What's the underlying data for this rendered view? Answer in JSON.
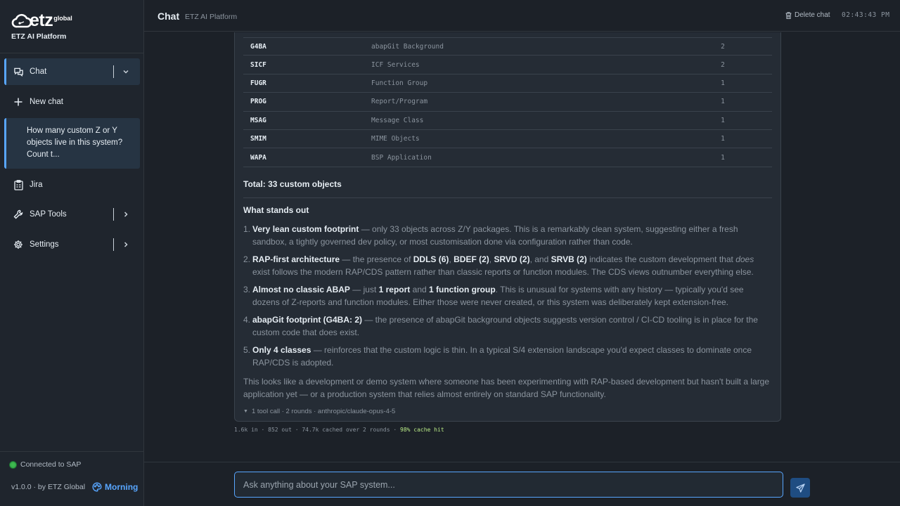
{
  "brand": {
    "logo_text": "etz",
    "logo_sup": "global",
    "subtitle": "ETZ AI Platform"
  },
  "sidebar": {
    "chat_label": "Chat",
    "new_chat_label": "New chat",
    "history_item": "How many custom Z or Y objects live in this system? Count t...",
    "jira_label": "Jira",
    "sap_tools_label": "SAP Tools",
    "settings_label": "Settings",
    "status": "Connected to SAP",
    "status_color": "#3fb950",
    "version": "v1.0.0 · by ETZ Global",
    "mode_label": "Morning"
  },
  "header": {
    "title": "Chat",
    "subtitle": "ETZ AI Platform",
    "delete_label": "Delete chat",
    "time": "02:43:43 PM"
  },
  "table": {
    "rows": [
      {
        "type": "G4BA",
        "desc": "abapGit Background",
        "count": "2"
      },
      {
        "type": "SICF",
        "desc": "ICF Services",
        "count": "2"
      },
      {
        "type": "FUGR",
        "desc": "Function Group",
        "count": "1"
      },
      {
        "type": "PROG",
        "desc": "Report/Program",
        "count": "1"
      },
      {
        "type": "MSAG",
        "desc": "Message Class",
        "count": "1"
      },
      {
        "type": "SMIM",
        "desc": "MIME Objects",
        "count": "1"
      },
      {
        "type": "WAPA",
        "desc": "BSP Application",
        "count": "1"
      }
    ]
  },
  "message": {
    "total": "Total: 33 custom objects",
    "heading": "What stands out",
    "items": [
      {
        "num": "1.",
        "b1": "Very lean custom footprint",
        "t1": " — only 33 objects across Z/Y packages. This is a remarkably clean system, suggesting either a fresh sandbox, a tightly governed dev policy, or most customisation done via configuration rather than code."
      },
      {
        "num": "2.",
        "b1": "RAP-first architecture",
        "t1": " — the presence of ",
        "b2": "DDLS (6)",
        "t2": ", ",
        "b3": "BDEF (2)",
        "t3": ", ",
        "b4": "SRVD (2)",
        "t4": ", and ",
        "b5": "SRVB (2)",
        "t5": " indicates the custom development that ",
        "em": "does",
        "t6": " exist follows the modern RAP/CDS pattern rather than classic reports or function modules. The CDS views outnumber everything else."
      },
      {
        "num": "3.",
        "b1": "Almost no classic ABAP",
        "t1": " — just ",
        "b2": "1 report",
        "t2": " and ",
        "b3": "1 function group",
        "t3": ". This is unusual for systems with any history — typically you'd see dozens of Z-reports and function modules. Either those were never created, or this system was deliberately kept extension-free."
      },
      {
        "num": "4.",
        "b1": "abapGit footprint (G4BA: 2)",
        "t1": " — the presence of abapGit background objects suggests version control / CI-CD tooling is in place for the custom code that does exist."
      },
      {
        "num": "5.",
        "b1": "Only 4 classes",
        "t1": " — reinforces that the custom logic is thin. In a typical S/4 extension landscape you'd expect classes to dominate once RAP/CDS is adopted."
      }
    ],
    "conclusion": "This looks like a development or demo system where someone has been experimenting with RAP-based development but hasn't built a large application yet — or a production system that relies almost entirely on standard SAP functionality.",
    "meta": "1 tool call · 2 rounds · anthropic/claude-opus-4-5"
  },
  "usage": {
    "text": "1.6k in · 852 out · 74.7k cached over 2 rounds · ",
    "hit": "98% cache hit"
  },
  "composer": {
    "placeholder": "Ask anything about your SAP system..."
  },
  "colors": {
    "accent": "#58a6ff",
    "background": "#1c2128",
    "sidebar": "#1f252d",
    "card": "#252c35"
  }
}
